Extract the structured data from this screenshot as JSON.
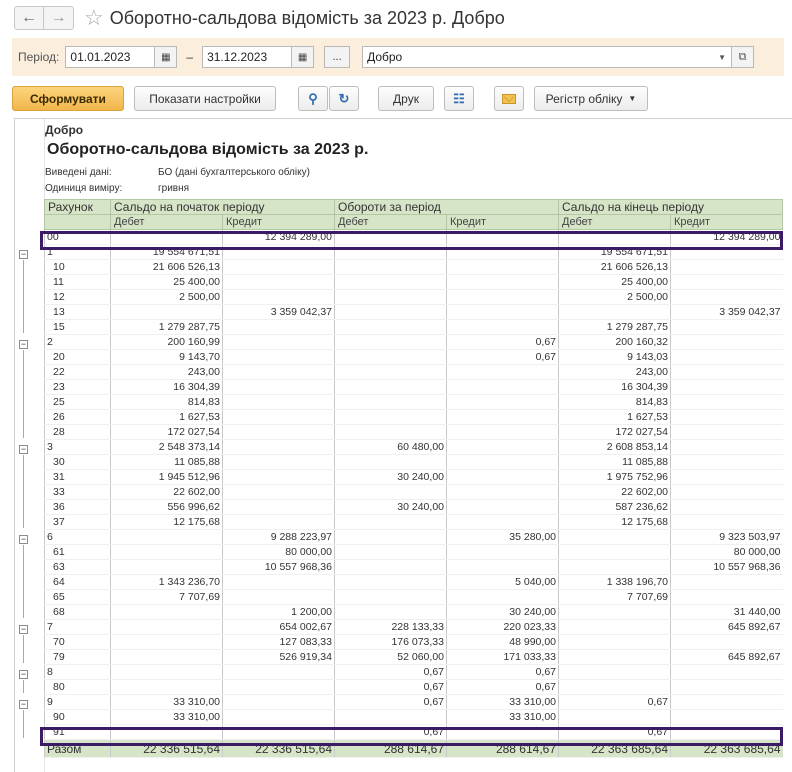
{
  "window": {
    "title": "Оборотно-сальдова відомість за 2023 р. Добро"
  },
  "period": {
    "label": "Період:",
    "from": "01.01.2023",
    "to": "31.12.2023",
    "dash": "–",
    "dots": "...",
    "organization": "Добро"
  },
  "toolbar": {
    "generate": "Сформувати",
    "show_settings": "Показати настройки",
    "print": "Друк",
    "register": "Регістр обліку"
  },
  "report": {
    "org": "Добро",
    "title": "Оборотно-сальдова відомість за 2023 р.",
    "data_label": "Виведені дані:",
    "data_value": "БО (дані бухгалтерського обліку)",
    "unit_label": "Одиниця виміру:",
    "unit_value": "гривня",
    "headers": {
      "account": "Рахунок",
      "opening": "Сальдо на початок періоду",
      "turnover": "Обороти за період",
      "closing": "Сальдо на кінець періоду",
      "debit": "Дебет",
      "credit": "Кредит"
    },
    "rows": [
      {
        "acc": "00",
        "lvl": 0,
        "od": "",
        "oc": "12 394 289,00",
        "td": "",
        "tc": "",
        "cd": "",
        "cc": "12 394 289,00"
      },
      {
        "acc": "1",
        "lvl": 0,
        "od": "19 554 671,51",
        "oc": "",
        "td": "",
        "tc": "",
        "cd": "19 554 671,51",
        "cc": ""
      },
      {
        "acc": "10",
        "lvl": 1,
        "od": "21 606 526,13",
        "oc": "",
        "td": "",
        "tc": "",
        "cd": "21 606 526,13",
        "cc": ""
      },
      {
        "acc": "11",
        "lvl": 1,
        "od": "25 400,00",
        "oc": "",
        "td": "",
        "tc": "",
        "cd": "25 400,00",
        "cc": ""
      },
      {
        "acc": "12",
        "lvl": 1,
        "od": "2 500,00",
        "oc": "",
        "td": "",
        "tc": "",
        "cd": "2 500,00",
        "cc": ""
      },
      {
        "acc": "13",
        "lvl": 1,
        "od": "",
        "oc": "3 359 042,37",
        "td": "",
        "tc": "",
        "cd": "",
        "cc": "3 359 042,37"
      },
      {
        "acc": "15",
        "lvl": 1,
        "od": "1 279 287,75",
        "oc": "",
        "td": "",
        "tc": "",
        "cd": "1 279 287,75",
        "cc": ""
      },
      {
        "acc": "2",
        "lvl": 0,
        "od": "200 160,99",
        "oc": "",
        "td": "",
        "tc": "0,67",
        "cd": "200 160,32",
        "cc": ""
      },
      {
        "acc": "20",
        "lvl": 1,
        "od": "9 143,70",
        "oc": "",
        "td": "",
        "tc": "0,67",
        "cd": "9 143,03",
        "cc": ""
      },
      {
        "acc": "22",
        "lvl": 1,
        "od": "243,00",
        "oc": "",
        "td": "",
        "tc": "",
        "cd": "243,00",
        "cc": ""
      },
      {
        "acc": "23",
        "lvl": 1,
        "od": "16 304,39",
        "oc": "",
        "td": "",
        "tc": "",
        "cd": "16 304,39",
        "cc": ""
      },
      {
        "acc": "25",
        "lvl": 1,
        "od": "814,83",
        "oc": "",
        "td": "",
        "tc": "",
        "cd": "814,83",
        "cc": ""
      },
      {
        "acc": "26",
        "lvl": 1,
        "od": "1 627,53",
        "oc": "",
        "td": "",
        "tc": "",
        "cd": "1 627,53",
        "cc": ""
      },
      {
        "acc": "28",
        "lvl": 1,
        "od": "172 027,54",
        "oc": "",
        "td": "",
        "tc": "",
        "cd": "172 027,54",
        "cc": ""
      },
      {
        "acc": "3",
        "lvl": 0,
        "od": "2 548 373,14",
        "oc": "",
        "td": "60 480,00",
        "tc": "",
        "cd": "2 608 853,14",
        "cc": ""
      },
      {
        "acc": "30",
        "lvl": 1,
        "od": "11 085,88",
        "oc": "",
        "td": "",
        "tc": "",
        "cd": "11 085,88",
        "cc": ""
      },
      {
        "acc": "31",
        "lvl": 1,
        "od": "1 945 512,96",
        "oc": "",
        "td": "30 240,00",
        "tc": "",
        "cd": "1 975 752,96",
        "cc": ""
      },
      {
        "acc": "33",
        "lvl": 1,
        "od": "22 602,00",
        "oc": "",
        "td": "",
        "tc": "",
        "cd": "22 602,00",
        "cc": ""
      },
      {
        "acc": "36",
        "lvl": 1,
        "od": "556 996,62",
        "oc": "",
        "td": "30 240,00",
        "tc": "",
        "cd": "587 236,62",
        "cc": ""
      },
      {
        "acc": "37",
        "lvl": 1,
        "od": "12 175,68",
        "oc": "",
        "td": "",
        "tc": "",
        "cd": "12 175,68",
        "cc": ""
      },
      {
        "acc": "6",
        "lvl": 0,
        "od": "",
        "oc": "9 288 223,97",
        "td": "",
        "tc": "35 280,00",
        "cd": "",
        "cc": "9 323 503,97"
      },
      {
        "acc": "61",
        "lvl": 1,
        "od": "",
        "oc": "80 000,00",
        "td": "",
        "tc": "",
        "cd": "",
        "cc": "80 000,00"
      },
      {
        "acc": "63",
        "lvl": 1,
        "od": "",
        "oc": "10 557 968,36",
        "td": "",
        "tc": "",
        "cd": "",
        "cc": "10 557 968,36"
      },
      {
        "acc": "64",
        "lvl": 1,
        "od": "1 343 236,70",
        "oc": "",
        "td": "",
        "tc": "5 040,00",
        "cd": "1 338 196,70",
        "cc": ""
      },
      {
        "acc": "65",
        "lvl": 1,
        "od": "7 707,69",
        "oc": "",
        "td": "",
        "tc": "",
        "cd": "7 707,69",
        "cc": ""
      },
      {
        "acc": "68",
        "lvl": 1,
        "od": "",
        "oc": "1 200,00",
        "td": "",
        "tc": "30 240,00",
        "cd": "",
        "cc": "31 440,00"
      },
      {
        "acc": "7",
        "lvl": 0,
        "od": "",
        "oc": "654 002,67",
        "td": "228 133,33",
        "tc": "220 023,33",
        "cd": "",
        "cc": "645 892,67"
      },
      {
        "acc": "70",
        "lvl": 1,
        "od": "",
        "oc": "127 083,33",
        "td": "176 073,33",
        "tc": "48 990,00",
        "cd": "",
        "cc": ""
      },
      {
        "acc": "79",
        "lvl": 1,
        "od": "",
        "oc": "526 919,34",
        "td": "52 060,00",
        "tc": "171 033,33",
        "cd": "",
        "cc": "645 892,67"
      },
      {
        "acc": "8",
        "lvl": 0,
        "od": "",
        "oc": "",
        "td": "0,67",
        "tc": "0,67",
        "cd": "",
        "cc": ""
      },
      {
        "acc": "80",
        "lvl": 1,
        "od": "",
        "oc": "",
        "td": "0,67",
        "tc": "0,67",
        "cd": "",
        "cc": ""
      },
      {
        "acc": "9",
        "lvl": 0,
        "od": "33 310,00",
        "oc": "",
        "td": "0,67",
        "tc": "33 310,00",
        "cd": "0,67",
        "cc": ""
      },
      {
        "acc": "90",
        "lvl": 1,
        "od": "33 310,00",
        "oc": "",
        "td": "",
        "tc": "33 310,00",
        "cd": "",
        "cc": ""
      },
      {
        "acc": "91",
        "lvl": 1,
        "od": "",
        "oc": "",
        "td": "0,67",
        "tc": "",
        "cd": "0,67",
        "cc": ""
      }
    ],
    "total": {
      "acc": "Разом",
      "od": "22 336 515,64",
      "oc": "22 336 515,64",
      "td": "288 614,67",
      "tc": "288 614,67",
      "cd": "22 363 685,64",
      "cc": "22 363 685,64"
    }
  }
}
